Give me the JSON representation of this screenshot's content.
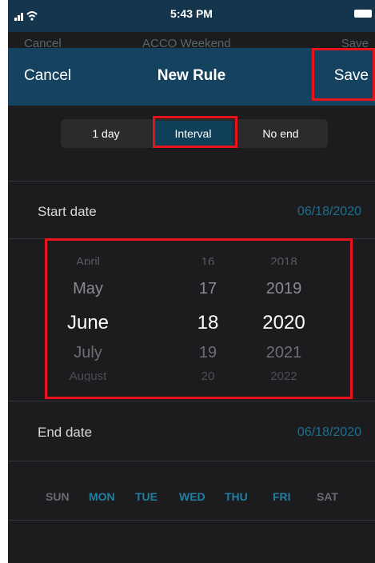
{
  "status_bar": {
    "time": "5:43 PM"
  },
  "ghost_header": {
    "cancel": "Cancel",
    "title": "ACCO Weekend",
    "save": "Save"
  },
  "nav": {
    "cancel_label": "Cancel",
    "title": "New Rule",
    "save_label": "Save"
  },
  "segments": [
    {
      "label": "1 day",
      "selected": false
    },
    {
      "label": "Interval",
      "selected": true
    },
    {
      "label": "No end",
      "selected": false
    }
  ],
  "start_date": {
    "label": "Start date",
    "value": "06/18/2020"
  },
  "picker": {
    "months": [
      "April",
      "May",
      "June",
      "July",
      "August"
    ],
    "days": [
      "16",
      "17",
      "18",
      "19",
      "20"
    ],
    "years": [
      "2018",
      "2019",
      "2020",
      "2021",
      "2022"
    ],
    "selected_month": "June",
    "selected_day": "18",
    "selected_year": "2020"
  },
  "end_date": {
    "label": "End date",
    "value": "06/18/2020"
  },
  "weekdays": [
    {
      "label": "SUN",
      "selected": false
    },
    {
      "label": "MON",
      "selected": true
    },
    {
      "label": "TUE",
      "selected": true
    },
    {
      "label": "WED",
      "selected": true
    },
    {
      "label": "THU",
      "selected": true
    },
    {
      "label": "FRI",
      "selected": true
    },
    {
      "label": "SAT",
      "selected": false
    }
  ],
  "colors": {
    "accent": "#1e6e8e",
    "weekday_selected": "#1f7fa3",
    "weekday_unselected": "#6a6a70",
    "nav_background": "#15425f",
    "highlight": "#e8141b"
  }
}
